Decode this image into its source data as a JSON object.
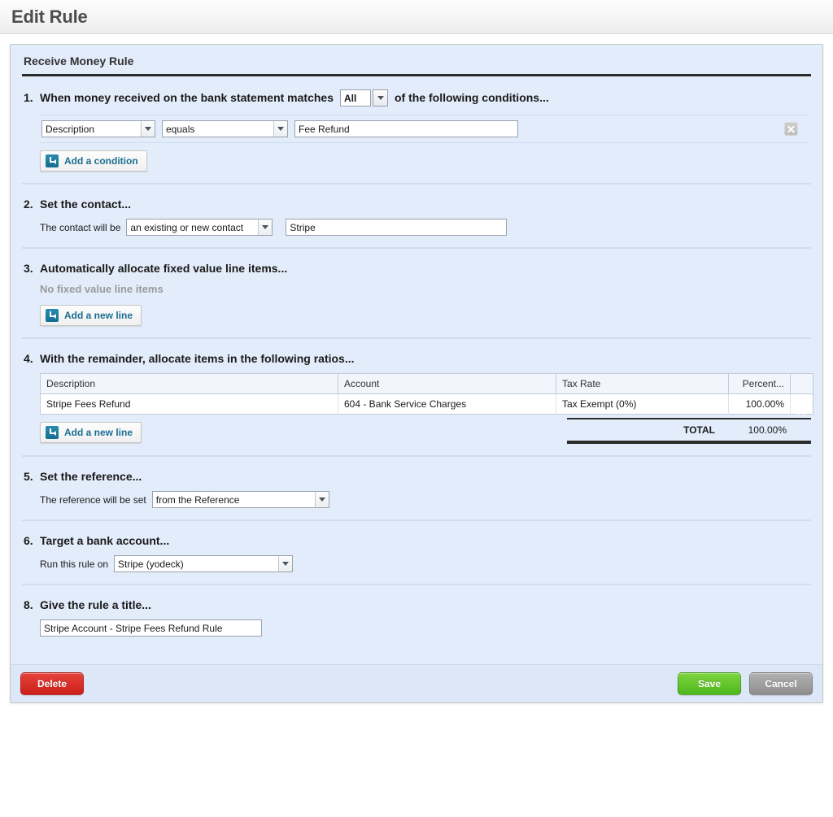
{
  "header": {
    "title": "Edit Rule"
  },
  "panel": {
    "title": "Receive Money Rule"
  },
  "sections": {
    "s1": {
      "num": "1.",
      "title": "When money received on the bank statement matches",
      "match_mode": "All",
      "tail": "of the following conditions...",
      "condition": {
        "field": "Description",
        "operator": "equals",
        "value": "Fee Refund",
        "remove_icon": "close-icon"
      },
      "add_button": {
        "label": "Add a condition",
        "icon": "enter-arrow-icon"
      }
    },
    "s2": {
      "num": "2.",
      "title": "Set the contact...",
      "label": "The contact will be",
      "contact_mode": "an existing or new contact",
      "contact_name": "Stripe"
    },
    "s3": {
      "num": "3.",
      "title": "Automatically allocate fixed value line items...",
      "empty_text": "No fixed value line items",
      "add_button": {
        "label": "Add a new line",
        "icon": "enter-arrow-icon"
      }
    },
    "s4": {
      "num": "4.",
      "title": "With the remainder, allocate items in the following ratios...",
      "add_button": {
        "label": "Add a new line",
        "icon": "enter-arrow-icon"
      },
      "table": {
        "columns": [
          "Description",
          "Account",
          "Tax Rate",
          "Percent...",
          ""
        ],
        "rows": [
          {
            "description": "Stripe Fees Refund",
            "account": "604 - Bank Service Charges",
            "tax_rate": "Tax Exempt (0%)",
            "percent": "100.00%",
            "remove_icon": "close-icon"
          }
        ],
        "total_label": "TOTAL",
        "total_value": "100.00%"
      }
    },
    "s5": {
      "num": "5.",
      "title": "Set the reference...",
      "label": "The reference will be set",
      "reference_mode": "from the Reference"
    },
    "s6": {
      "num": "6.",
      "title": "Target a bank account...",
      "label": "Run this rule on",
      "bank_account": "Stripe (yodeck)"
    },
    "s8": {
      "num": "8.",
      "title": "Give the rule a title...",
      "rule_title": "Stripe Account - Stripe Fees Refund Rule"
    }
  },
  "footer": {
    "delete_label": "Delete",
    "save_label": "Save",
    "cancel_label": "Cancel"
  },
  "colors": {
    "panel_bg": "#e3ecfa",
    "accent_link": "#1a6e92",
    "delete_red": "#cc1f18",
    "save_green": "#4eb81c",
    "cancel_gray": "#8e8e8e"
  }
}
